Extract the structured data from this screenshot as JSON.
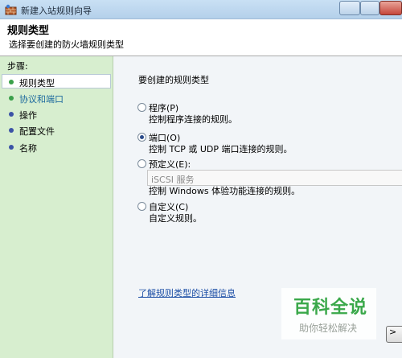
{
  "window": {
    "title": "新建入站规则向导"
  },
  "header": {
    "title": "规则类型",
    "subtitle": "选择要创建的防火墙规则类型"
  },
  "sidebar": {
    "steps_label": "步骤:",
    "items": [
      {
        "label": "规则类型"
      },
      {
        "label": "协议和端口"
      },
      {
        "label": "操作"
      },
      {
        "label": "配置文件"
      },
      {
        "label": "名称"
      }
    ]
  },
  "main": {
    "prompt": "要创建的规则类型",
    "options": [
      {
        "title": "程序(P)",
        "desc": "控制程序连接的规则。",
        "selected": false
      },
      {
        "title": "端口(O)",
        "desc": "控制 TCP 或 UDP 端口连接的规则。",
        "selected": true
      },
      {
        "title": "预定义(E):",
        "desc": "控制 Windows 体验功能连接的规则。",
        "selected": false
      },
      {
        "title": "自定义(C)",
        "desc": "自定义规则。",
        "selected": false
      }
    ],
    "predefined_value": "iSCSI 服务",
    "learn_more": "了解规则类型的详细信息",
    "next_label": ">"
  },
  "watermark": {
    "title": "百科全说",
    "subtitle": "助你轻松解决"
  },
  "colors": {
    "sidebar_bg": "#d7eecf",
    "link": "#1d4fa6",
    "step_done": "#3aa04a",
    "step_todo": "#3b53a6"
  }
}
